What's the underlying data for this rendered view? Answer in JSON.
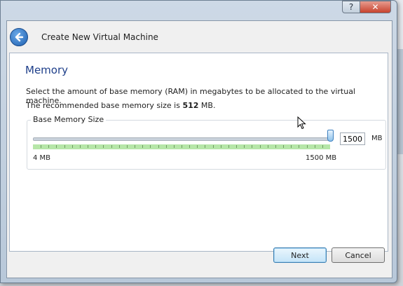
{
  "dialog": {
    "title": "Create New Virtual Machine",
    "help_glyph": "?",
    "close_glyph": "✕"
  },
  "page": {
    "heading": "Memory",
    "description_line1": "Select the amount of base memory (RAM) in megabytes to be allocated to the virtual machine.",
    "description_line2_prefix": "The recommended base memory size is ",
    "recommended_value": "512",
    "description_line2_suffix": " MB."
  },
  "memory": {
    "group_label": "Base Memory Size",
    "min_label": "4 MB",
    "max_label": "1500 MB",
    "value": "1500",
    "unit": "MB",
    "slider_fraction": 1.0
  },
  "buttons": {
    "next": "Next",
    "cancel": "Cancel"
  },
  "colors": {
    "heading": "#1e3f8a",
    "tick_band": "#b6e6a8",
    "accent": "#3c7fbf"
  }
}
